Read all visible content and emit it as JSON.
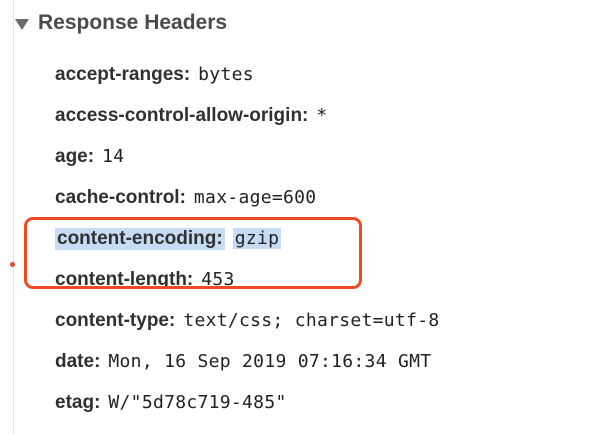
{
  "section": {
    "title": "Response Headers",
    "expanded": true
  },
  "headers": [
    {
      "name": "accept-ranges:",
      "value": "bytes",
      "highlighted": false
    },
    {
      "name": "access-control-allow-origin:",
      "value": "*",
      "highlighted": false
    },
    {
      "name": "age:",
      "value": "14",
      "highlighted": false
    },
    {
      "name": "cache-control:",
      "value": "max-age=600",
      "highlighted": false
    },
    {
      "name": "content-encoding:",
      "value": "gzip",
      "highlighted": true
    },
    {
      "name": "content-length:",
      "value": "453",
      "highlighted": false
    },
    {
      "name": "content-type:",
      "value": "text/css; charset=utf-8",
      "highlighted": false
    },
    {
      "name": "date:",
      "value": "Mon, 16 Sep 2019 07:16:34 GMT",
      "highlighted": false
    },
    {
      "name": "etag:",
      "value": "W/\"5d78c719-485\"",
      "highlighted": false
    }
  ],
  "colors": {
    "annotation": "#f04a22",
    "selection": "#c6dcf4"
  }
}
